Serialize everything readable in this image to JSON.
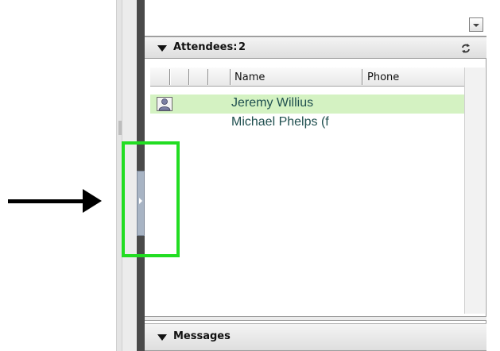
{
  "attendees": {
    "title": "Attendees:",
    "count": "2",
    "columns": {
      "name": "Name",
      "phone": "Phone"
    },
    "rows": [
      {
        "name": "Jeremy Willius",
        "phone": "",
        "selected": true,
        "icon": "user-icon"
      },
      {
        "name": "Michael Phelps (f",
        "phone": "",
        "selected": false,
        "icon": ""
      }
    ]
  },
  "messages": {
    "title": "Messages"
  },
  "icons": {
    "dropdown": "chevron-down-icon",
    "refresh": "refresh-icon",
    "collapse_handle": "chevron-right-icon"
  },
  "colors": {
    "selected_row": "#d4f2c2",
    "callout": "#22dd22",
    "name_text": "#1f4f4f",
    "divider": "#4a4a4a"
  }
}
